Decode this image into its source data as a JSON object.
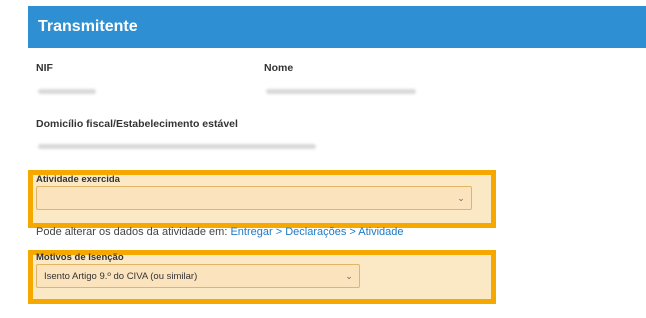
{
  "section": {
    "title": "Transmitente"
  },
  "fields": {
    "nif_label": "NIF",
    "nome_label": "Nome",
    "domicilio_label": "Domicílio fiscal/Estabelecimento estável"
  },
  "atividade": {
    "label": "Atividade exercida",
    "value": "",
    "chevron": "⌄"
  },
  "info": {
    "text": "Pode alterar os dados da atividade em: ",
    "link": "Entregar > Declarações > Atividade"
  },
  "isencao": {
    "label": "Motivos de Isenção",
    "value": "Isento Artigo 9.º do CIVA (ou similar)",
    "chevron": "⌄"
  },
  "colors": {
    "header": "#2f8fd3",
    "highlight": "#f5a800",
    "link": "#1f7ac4"
  }
}
